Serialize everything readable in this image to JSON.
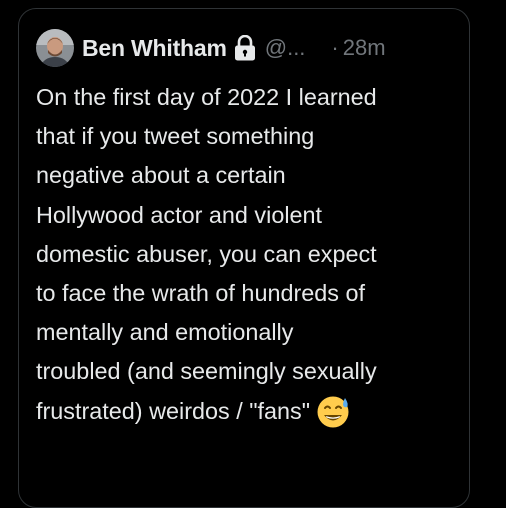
{
  "tweet": {
    "author_name": "Ben Whitham",
    "handle": "@...",
    "separator": "·",
    "timestamp": "28m",
    "avatar_icon": "avatar-photo",
    "lock_icon": "lock-icon",
    "body_lines": [
      "On the first day of 2022 I learned",
      "that if you tweet something",
      "negative about a certain",
      "Hollywood actor and violent",
      "domestic abuser, you can expect",
      "to face the wrath of hundreds of",
      "mentally and emotionally",
      "troubled (and seemingly sexually",
      "frustrated) weirdos / \"fans\""
    ],
    "trailing_emoji": "grinning-face-with-sweat-emoji"
  },
  "colors": {
    "background": "#000000",
    "card_border": "#2f3336",
    "primary_text": "#e7e9ea",
    "secondary_text": "#71767b"
  }
}
